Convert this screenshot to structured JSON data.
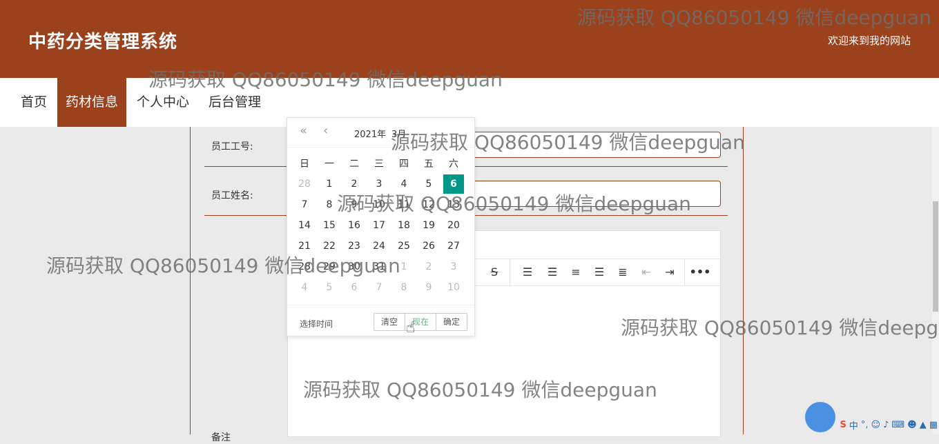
{
  "header": {
    "title": "中药分类管理系统",
    "welcome": "欢迎来到我的网站"
  },
  "nav": {
    "items": [
      {
        "label": "首页"
      },
      {
        "label": "药材信息",
        "active": true
      },
      {
        "label": "个人中心"
      },
      {
        "label": "后台管理"
      }
    ]
  },
  "form": {
    "employee_id_label": "员工工号:",
    "employee_name_label": "员工姓名:",
    "remark_label": "备注"
  },
  "editor_toolbar": {
    "icons": [
      "strikethrough-icon",
      "line-height-icon",
      "align-left-icon",
      "align-center-icon",
      "align-right-icon",
      "align-justify-icon",
      "outdent-icon",
      "indent-icon",
      "more-icon"
    ]
  },
  "datepicker": {
    "year": "2021年",
    "month": "3月",
    "weekdays": [
      "日",
      "一",
      "二",
      "三",
      "四",
      "五",
      "六"
    ],
    "weeks": [
      [
        {
          "d": "28",
          "m": true
        },
        {
          "d": "1"
        },
        {
          "d": "2"
        },
        {
          "d": "3"
        },
        {
          "d": "4"
        },
        {
          "d": "5"
        },
        {
          "d": "6",
          "sel": true
        }
      ],
      [
        {
          "d": "7"
        },
        {
          "d": "8"
        },
        {
          "d": "9"
        },
        {
          "d": "10"
        },
        {
          "d": "11"
        },
        {
          "d": "12"
        },
        {
          "d": "13"
        }
      ],
      [
        {
          "d": "14"
        },
        {
          "d": "15"
        },
        {
          "d": "16"
        },
        {
          "d": "17"
        },
        {
          "d": "18"
        },
        {
          "d": "19"
        },
        {
          "d": "20"
        }
      ],
      [
        {
          "d": "21"
        },
        {
          "d": "22"
        },
        {
          "d": "23"
        },
        {
          "d": "24"
        },
        {
          "d": "25"
        },
        {
          "d": "26"
        },
        {
          "d": "27"
        }
      ],
      [
        {
          "d": "28"
        },
        {
          "d": "29"
        },
        {
          "d": "30"
        },
        {
          "d": "31"
        },
        {
          "d": "1",
          "m": true
        },
        {
          "d": "2",
          "m": true
        },
        {
          "d": "3",
          "m": true
        }
      ],
      [
        {
          "d": "4",
          "m": true
        },
        {
          "d": "5",
          "m": true
        },
        {
          "d": "6",
          "m": true
        },
        {
          "d": "7",
          "m": true
        },
        {
          "d": "8",
          "m": true
        },
        {
          "d": "9",
          "m": true
        },
        {
          "d": "10",
          "m": true
        }
      ]
    ],
    "select_time": "选择时间",
    "clear": "清空",
    "now": "现在",
    "confirm": "确定"
  },
  "watermark": "源码获取 QQ86050149 微信deepguan",
  "colors": {
    "brand": "#9b411c",
    "selected_day": "#009688"
  }
}
